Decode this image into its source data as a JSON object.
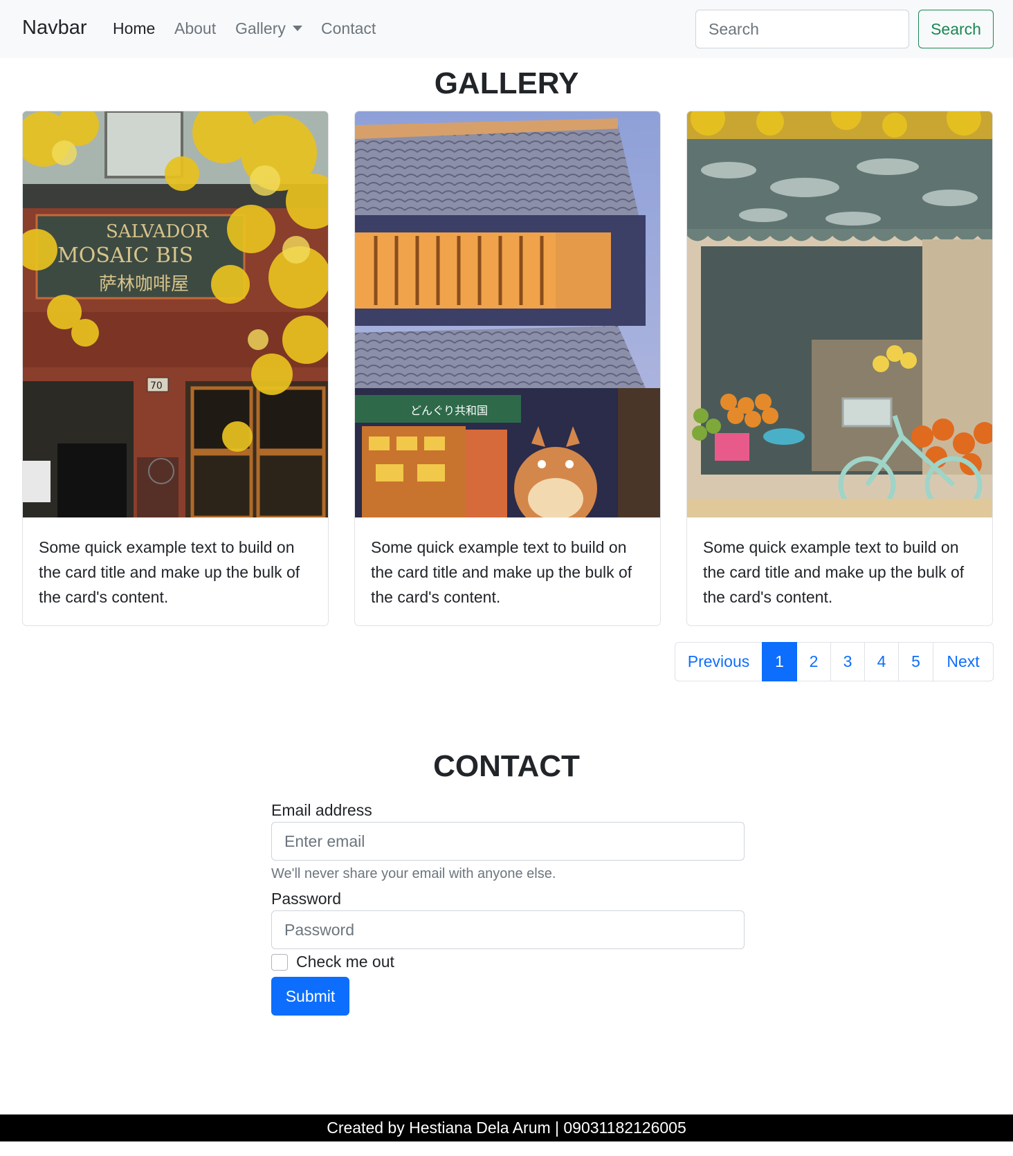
{
  "navbar": {
    "brand": "Navbar",
    "links": [
      {
        "label": "Home"
      },
      {
        "label": "About"
      },
      {
        "label": "Gallery"
      },
      {
        "label": "Contact"
      }
    ],
    "search_placeholder": "Search",
    "search_button": "Search"
  },
  "gallery": {
    "title": "GALLERY",
    "cards": [
      {
        "text": "Some quick example text to build on the card title and make up the bulk of the card's content."
      },
      {
        "text": "Some quick example text to build on the card title and make up the bulk of the card's content."
      },
      {
        "text": "Some quick example text to build on the card title and make up the bulk of the card's content."
      }
    ],
    "image_signs": {
      "card1_line1": "SALVADOR",
      "card1_line2": "MOSAIC BIS",
      "card1_line3": "萨林咖啡屋",
      "card1_number": "70",
      "card2_sign": "どんぐり共和国"
    },
    "pagination": {
      "previous": "Previous",
      "pages": [
        "1",
        "2",
        "3",
        "4",
        "5"
      ],
      "active_page": "1",
      "next": "Next"
    }
  },
  "contact": {
    "title": "CONTACT",
    "email_label": "Email address",
    "email_placeholder": "Enter email",
    "email_help": "We'll never share your email with anyone else.",
    "password_label": "Password",
    "password_placeholder": "Password",
    "checkbox_label": "Check me out",
    "submit_label": "Submit"
  },
  "footer": {
    "text": "Created by Hestiana Dela Arum | 09031182126005"
  },
  "colors": {
    "primary": "#0d6efd",
    "success": "#198754",
    "navbar_bg": "#f8f9fa",
    "footer_bg": "#000000"
  }
}
